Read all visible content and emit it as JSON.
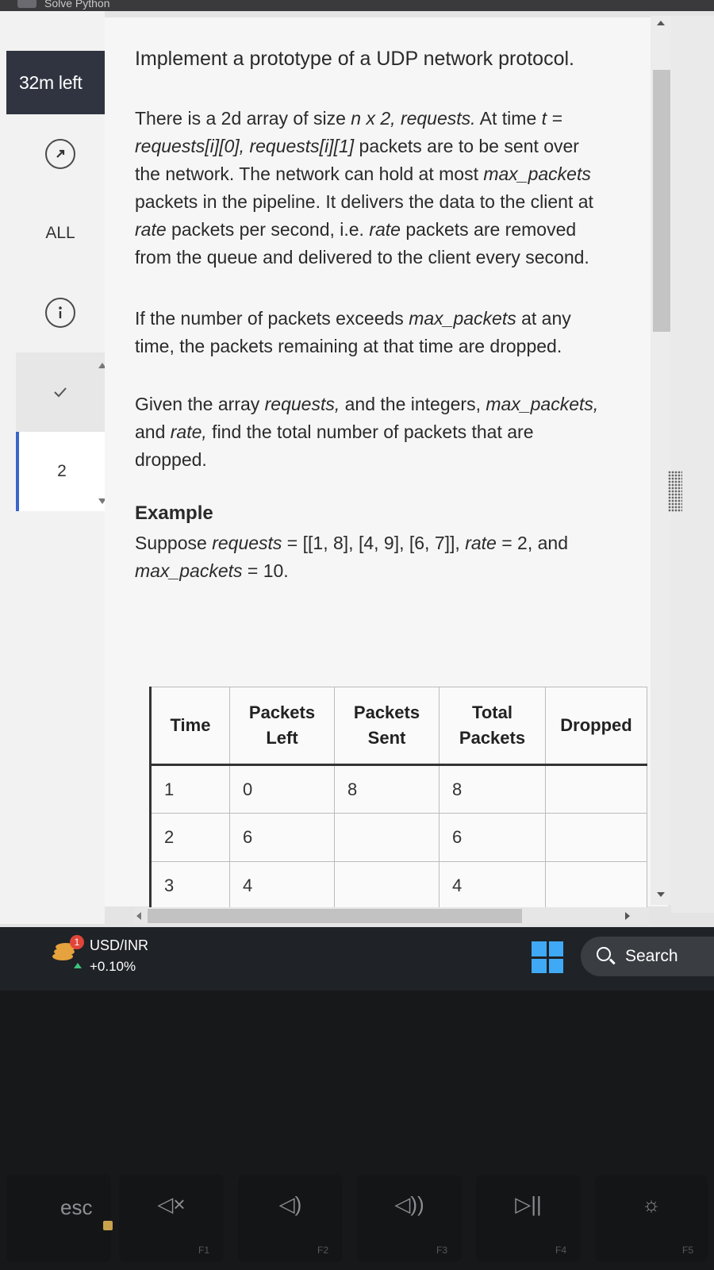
{
  "browser": {
    "tab_title": "Solve Python"
  },
  "sidebar": {
    "timer": "32m left",
    "filter_label": "ALL",
    "question_number": "2",
    "icons": [
      "pointer-icon",
      "info-icon",
      "check-icon"
    ]
  },
  "problem": {
    "title": "Implement a prototype of a UDP network protocol.",
    "para1_a": "There is a 2d array of size ",
    "para1_b": "n x 2, requests.",
    "para1_c": " At time ",
    "para1_d": "t = requests[i][0], requests[i][1]",
    "para1_e": " packets are to be sent over the network. The network can hold at most ",
    "para1_f": "max_packets",
    "para1_g": " packets in the pipeline. It delivers the data to the client at ",
    "para1_h": "rate",
    "para1_i": " packets per second, i.e. ",
    "para1_j": "rate",
    "para1_k": " packets are removed from the queue and delivered to the client every second.",
    "para2_a": "If the number of packets exceeds ",
    "para2_b": "max_packets",
    "para2_c": " at any time, the packets remaining at that time are dropped.",
    "para3_a": "Given the array ",
    "para3_b": "requests,",
    "para3_c": " and the integers, ",
    "para3_d": "max_packets,",
    "para3_e": " and ",
    "para3_f": "rate,",
    "para3_g": " find the total number of packets that are dropped.",
    "example_heading": "Example",
    "example_a": "Suppose ",
    "example_b": "requests",
    "example_c": " = [[1, 8], [4, 9], [6, 7]], ",
    "example_d": "rate",
    "example_e": " = 2, and ",
    "example_f": "max_packets",
    "example_g": " = 10."
  },
  "table": {
    "headers": [
      {
        "line1": "Time",
        "line2": ""
      },
      {
        "line1": "Packets",
        "line2": "Left"
      },
      {
        "line1": "Packets",
        "line2": "Sent"
      },
      {
        "line1": "Total",
        "line2": "Packets"
      },
      {
        "line1": "Dropped",
        "line2": ""
      }
    ],
    "rows": [
      [
        "1",
        "0",
        "8",
        "8",
        ""
      ],
      [
        "2",
        "6",
        "",
        "6",
        ""
      ],
      [
        "3",
        "4",
        "",
        "4",
        ""
      ]
    ]
  },
  "taskbar": {
    "widget_badge": "1",
    "widget_title": "USD/INR",
    "widget_change": "+0.10%",
    "search_label": "Search",
    "colors": {
      "windows_logo": "#3fa9f5",
      "change_up": "#3cc47c",
      "badge": "#e0453a"
    }
  },
  "keyboard": {
    "keys": [
      {
        "main": "esc",
        "sub": ""
      },
      {
        "main": "◁×",
        "sub": "F1"
      },
      {
        "main": "◁)",
        "sub": "F2"
      },
      {
        "main": "◁))",
        "sub": "F3"
      },
      {
        "main": "▷||",
        "sub": "F4"
      },
      {
        "main": "☼",
        "sub": "F5"
      }
    ]
  }
}
